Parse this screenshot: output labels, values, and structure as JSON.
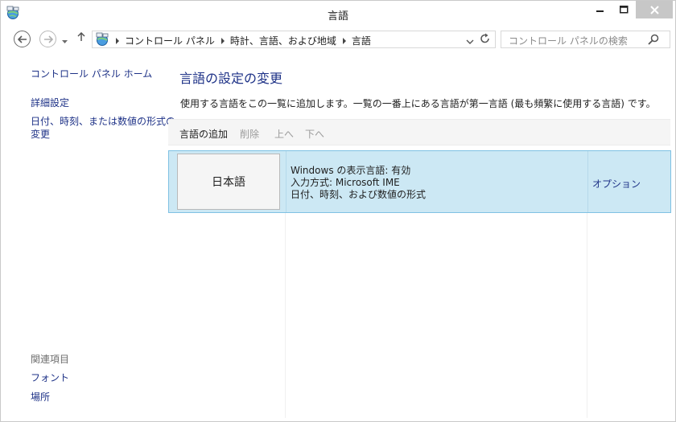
{
  "window": {
    "title": "言語"
  },
  "addressbar": {
    "crumbs": [
      "コントロール パネル",
      "時計、言語、および地域",
      "言語"
    ],
    "search_placeholder": "コントロール パネルの検索"
  },
  "sidebar": {
    "home": "コントロール パネル ホーム",
    "advanced": "詳細設定",
    "date_line1": "日付、時刻、または数値の形式の",
    "date_line2": "変更",
    "related_heading": "関連項目",
    "related": [
      "フォント",
      "場所"
    ]
  },
  "main": {
    "title": "言語の設定の変更",
    "description": "使用する言語をこの一覧に追加します。一覧の一番上にある言語が第一言語 (最も頻繁に使用する言語) です。",
    "toolbar": {
      "add": "言語の追加",
      "remove": "削除",
      "up": "上へ",
      "down": "下へ"
    },
    "languages": [
      {
        "name": "日本語",
        "info": [
          "Windows の表示言語: 有効",
          "入力方式: Microsoft IME",
          "日付、時刻、および数値の形式"
        ],
        "options": "オプション"
      }
    ]
  },
  "colors": {
    "link": "#1e3287",
    "selection_bg": "#cce8f4",
    "selection_border": "#7fc1e3",
    "close_button": "#c7c7c7"
  },
  "icons": {
    "app": "control-panel-globe-icon",
    "back": "back-arrow-icon",
    "forward": "forward-arrow-icon",
    "recent": "chevron-down-icon",
    "up": "up-arrow-icon",
    "refresh": "refresh-icon",
    "search": "search-icon"
  }
}
